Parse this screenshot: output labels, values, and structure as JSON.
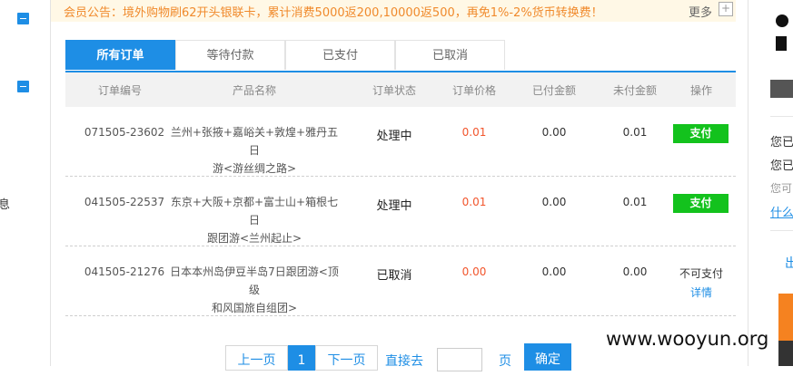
{
  "notice": {
    "text": "会员公告：境外购物刷62开头银联卡，累计消费5000返200,10000返500，再免1%-2%货币转换费！",
    "more_label": "更多",
    "more_icon": "+"
  },
  "sidebar": {
    "partial_text": "息"
  },
  "tabs": [
    {
      "label": "所有订单",
      "active": true
    },
    {
      "label": "等待付款",
      "active": false
    },
    {
      "label": "已支付",
      "active": false
    },
    {
      "label": "已取消",
      "active": false
    }
  ],
  "table": {
    "headers": [
      "订单编号",
      "产品名称",
      "订单状态",
      "订单价格",
      "已付金额",
      "未付金额",
      "操作"
    ],
    "rows": [
      {
        "order_id": "071505-23602",
        "product_line1": "兰州+张掖+嘉峪关+敦煌+雅丹五日",
        "product_line2": "游<游丝绸之路>",
        "status": "处理中",
        "price": "0.01",
        "paid": "0.00",
        "unpaid": "0.01",
        "action": "支付"
      },
      {
        "order_id": "041505-22537",
        "product_line1": "东京+大阪+京都+富士山+箱根七日",
        "product_line2": "跟团游<兰州起止>",
        "status": "处理中",
        "price": "0.01",
        "paid": "0.00",
        "unpaid": "0.01",
        "action": "支付"
      },
      {
        "order_id": "041505-21276",
        "product_line1": "日本本州岛伊豆半岛7日跟团游<顶级",
        "product_line2": "和风国旅自组团>",
        "status": "已取消",
        "price": "0.00",
        "paid": "0.00",
        "unpaid": "0.00",
        "action": "不可支付",
        "detail": "详情"
      }
    ]
  },
  "pagination": {
    "prev": "上一页",
    "current": "1",
    "next": "下一页",
    "goto": "直接去",
    "unit": "页",
    "confirm": "确定"
  },
  "right_panel": {
    "line1": "您已",
    "line2": "您已",
    "line3": "您可",
    "link": "什么",
    "link2": "出"
  },
  "watermark": "www.wooyun.org",
  "colors": {
    "accent": "#1e8ee5",
    "pay_button": "#13c21d",
    "price": "#f2552c",
    "notice": "#f08a2c"
  }
}
